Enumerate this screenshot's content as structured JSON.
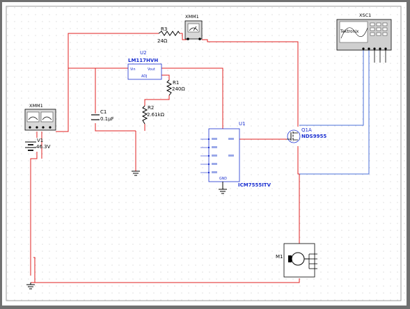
{
  "components": {
    "r3": {
      "ref": "R3",
      "value": "24Ω"
    },
    "xmm1_top": {
      "ref": "XMM1"
    },
    "xsc1": {
      "ref": "XSC1",
      "brand": "Tektronix"
    },
    "u2": {
      "ref": "U2",
      "part": "LM117HVH",
      "pin_vin": "Vin",
      "pin_vout": "Vout",
      "pin_adj": "ADJ"
    },
    "r1": {
      "ref": "R1",
      "value": "240Ω"
    },
    "c1": {
      "ref": "C1",
      "value": "0.1µF"
    },
    "r2": {
      "ref": "R2",
      "value": "2.61kΩ"
    },
    "xmm1_left": {
      "ref": "XMM1"
    },
    "v1": {
      "ref": "V1",
      "value": "46.3V"
    },
    "u1": {
      "ref": "U1",
      "part": "ICM7555ITV",
      "pin_gnd": "GND"
    },
    "q1a": {
      "ref": "Q1A",
      "part": "NDS9955"
    },
    "m1": {
      "ref": "M1"
    }
  },
  "colors": {
    "wire": "#e02020",
    "scope_wire": "#4a6fd8",
    "label": "#1a2fd0",
    "component": "#000000",
    "grid_dot": "#b8b8b8"
  }
}
